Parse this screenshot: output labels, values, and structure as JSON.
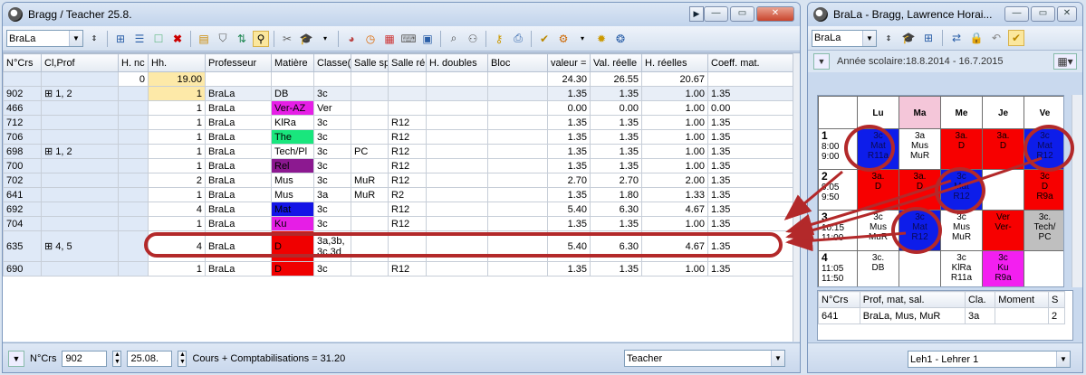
{
  "main_window": {
    "title": "Bragg / Teacher 25.8.",
    "toolbar_combo": "BraLa",
    "columns": [
      "N°Crs",
      "Cl,Prof",
      "H. nc",
      "Hh.",
      "Professeur",
      "Matière",
      "Classe(",
      "Salle sp",
      "Salle ré",
      "H. doubles",
      "Bloc",
      "valeur =",
      "Val. réelle",
      "H. réelles",
      "Coeff. mat."
    ],
    "sum_row": {
      "hnc": "0",
      "hh": "19.00",
      "valeur": "24.30",
      "val_reelle": "26.55",
      "h_reelles": "20.67"
    },
    "rows": [
      {
        "crs": "902",
        "clprof": "1, 2",
        "expand": true,
        "hh": "1",
        "prof": "BraLa",
        "mat": "DB",
        "mat_color": "#ffffff",
        "cls": "3c",
        "salle_sp": "",
        "salle_re": "",
        "valeur": "1.35",
        "val_reelle": "1.35",
        "h_reelles": "1.00",
        "coeff": "1.35"
      },
      {
        "crs": "466",
        "clprof": "",
        "expand": false,
        "hh": "1",
        "prof": "BraLa",
        "mat": "Ver-AZ",
        "mat_color": "#e61ee6",
        "cls": "Ver",
        "salle_sp": "",
        "salle_re": "",
        "valeur": "0.00",
        "val_reelle": "0.00",
        "h_reelles": "1.00",
        "coeff": "0.00"
      },
      {
        "crs": "712",
        "clprof": "",
        "expand": false,
        "hh": "1",
        "prof": "BraLa",
        "mat": "KlRa",
        "mat_color": "#ffffff",
        "cls": "3c",
        "salle_sp": "",
        "salle_re": "R12",
        "valeur": "1.35",
        "val_reelle": "1.35",
        "h_reelles": "1.00",
        "coeff": "1.35"
      },
      {
        "crs": "706",
        "clprof": "",
        "expand": false,
        "hh": "1",
        "prof": "BraLa",
        "mat": "The",
        "mat_color": "#19e67d",
        "cls": "3c",
        "salle_sp": "",
        "salle_re": "R12",
        "valeur": "1.35",
        "val_reelle": "1.35",
        "h_reelles": "1.00",
        "coeff": "1.35"
      },
      {
        "crs": "698",
        "clprof": "1, 2",
        "expand": true,
        "hh": "1",
        "prof": "BraLa",
        "mat": "Tech/Pl",
        "mat_color": "#ffffff",
        "cls": "3c",
        "salle_sp": "PC",
        "salle_re": "R12",
        "valeur": "1.35",
        "val_reelle": "1.35",
        "h_reelles": "1.00",
        "coeff": "1.35"
      },
      {
        "crs": "700",
        "clprof": "",
        "expand": false,
        "hh": "1",
        "prof": "BraLa",
        "mat": "Rel",
        "mat_color": "#8c1990",
        "cls": "3c",
        "salle_sp": "",
        "salle_re": "R12",
        "valeur": "1.35",
        "val_reelle": "1.35",
        "h_reelles": "1.00",
        "coeff": "1.35"
      },
      {
        "crs": "702",
        "clprof": "",
        "expand": false,
        "hh": "2",
        "prof": "BraLa",
        "mat": "Mus",
        "mat_color": "#ffffff",
        "cls": "3c",
        "salle_sp": "MuR",
        "salle_re": "R12",
        "valeur": "2.70",
        "val_reelle": "2.70",
        "h_reelles": "2.00",
        "coeff": "1.35"
      },
      {
        "crs": "641",
        "clprof": "",
        "expand": false,
        "hh": "1",
        "prof": "BraLa",
        "mat": "Mus",
        "mat_color": "#ffffff",
        "cls": "3a",
        "salle_sp": "MuR",
        "salle_re": "R2",
        "valeur": "1.35",
        "val_reelle": "1.80",
        "h_reelles": "1.33",
        "coeff": "1.35"
      },
      {
        "crs": "692",
        "clprof": "",
        "expand": false,
        "hh": "4",
        "prof": "BraLa",
        "mat": "Mat",
        "mat_color": "#1414e6",
        "cls": "3c",
        "salle_sp": "",
        "salle_re": "R12",
        "valeur": "5.40",
        "val_reelle": "6.30",
        "h_reelles": "4.67",
        "coeff": "1.35",
        "highlight": true
      },
      {
        "crs": "704",
        "clprof": "",
        "expand": false,
        "hh": "1",
        "prof": "BraLa",
        "mat": "Ku",
        "mat_color": "#e61ee6",
        "cls": "3c",
        "salle_sp": "",
        "salle_re": "R12",
        "valeur": "1.35",
        "val_reelle": "1.35",
        "h_reelles": "1.00",
        "coeff": "1.35"
      },
      {
        "crs": "635",
        "clprof": "4, 5",
        "expand": true,
        "hh": "4",
        "prof": "BraLa",
        "mat": "D",
        "mat_color": "#f00000",
        "cls": "3a,3b,\n3c,3d",
        "salle_sp": "",
        "salle_re": "",
        "valeur": "5.40",
        "val_reelle": "6.30",
        "h_reelles": "4.67",
        "coeff": "1.35",
        "tall": true
      },
      {
        "crs": "690",
        "clprof": "",
        "expand": false,
        "hh": "1",
        "prof": "BraLa",
        "mat": "D",
        "mat_color": "#f00000",
        "cls": "3c",
        "salle_sp": "",
        "salle_re": "R12",
        "valeur": "1.35",
        "val_reelle": "1.35",
        "h_reelles": "1.00",
        "coeff": "1.35"
      }
    ],
    "status": {
      "label": "N°Crs",
      "crs": "902",
      "date": "25.08.",
      "summary": "Cours + Comptabilisations = 31.20",
      "view": "Teacher"
    }
  },
  "timetable_window": {
    "title": "BraLa - Bragg, Lawrence Horai...",
    "combo": "BraLa",
    "year": "Année scolaire:18.8.2014 - 16.7.2015",
    "days": [
      "Lu",
      "Ma",
      "Me",
      "Je",
      "Ve"
    ],
    "periods": [
      {
        "num": "1",
        "start": "8:00",
        "end": "9:00"
      },
      {
        "num": "2",
        "start": "9:05",
        "end": "9:50"
      },
      {
        "num": "3",
        "start": "10:15",
        "end": "11:00"
      },
      {
        "num": "4",
        "start": "11:05",
        "end": "11:50"
      }
    ],
    "cells": [
      [
        {
          "t": "3c\nMat\nR11a",
          "c": "c-blue"
        },
        {
          "t": "3a\nMus\nMuR",
          "c": "c-white"
        },
        {
          "t": "3a.\nD",
          "c": "c-red"
        },
        {
          "t": "3a.\nD",
          "c": "c-red"
        },
        {
          "t": "3c\nMat\nR12",
          "c": "c-blue"
        }
      ],
      [
        {
          "t": "3a.\nD",
          "c": "c-red"
        },
        {
          "t": "3a.\nD",
          "c": "c-red"
        },
        {
          "t": "3c\nMat\nR12",
          "c": "c-blue"
        },
        {
          "t": "",
          "c": "c-white"
        },
        {
          "t": "3c\nD\nR9a",
          "c": "c-red"
        }
      ],
      [
        {
          "t": "3c\nMus\nMuR",
          "c": "c-white"
        },
        {
          "t": "3c\nMat\nR12",
          "c": "c-blue"
        },
        {
          "t": "3c\nMus\nMuR",
          "c": "c-white"
        },
        {
          "t": "Ver\nVer-",
          "c": "c-red"
        },
        {
          "t": "3c.\nTech/\nPC",
          "c": "c-grey"
        }
      ],
      [
        {
          "t": "3c.\nDB",
          "c": "c-white"
        },
        {
          "t": "",
          "c": "c-white"
        },
        {
          "t": "3c\nKlRa\nR11a",
          "c": "c-white"
        },
        {
          "t": "3c\nKu\nR9a",
          "c": "c-mag"
        },
        {
          "t": "",
          "c": "c-white"
        }
      ]
    ],
    "lower_cols": [
      "N°Crs",
      "Prof, mat, sal.",
      "Cla.",
      "Moment",
      "S"
    ],
    "lower_row": {
      "crs": "641",
      "desc": "BraLa, Mus, MuR",
      "cla": "3a",
      "moment": "",
      "s": "2"
    },
    "status": "Leh1 - Lehrer 1"
  }
}
